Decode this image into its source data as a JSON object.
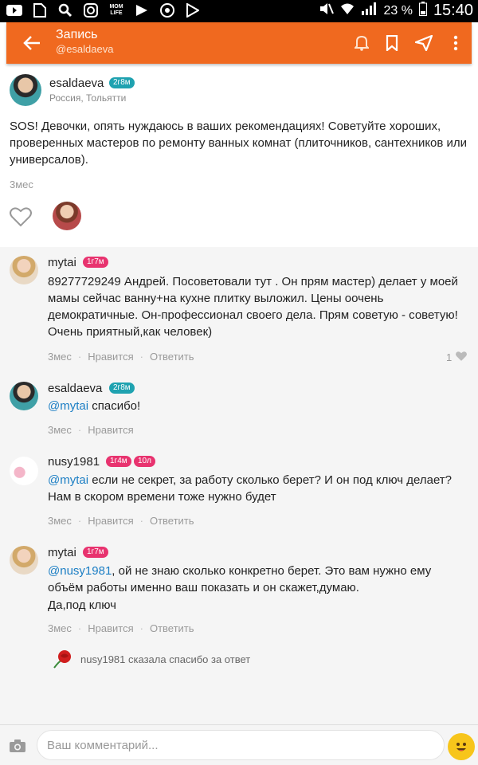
{
  "status_bar": {
    "icons": [
      "youtube-icon",
      "file-icon",
      "search-icon",
      "instagram-icon",
      "momlife-icon",
      "sportlink-icon",
      "chrome-icon",
      "play-store-icon"
    ],
    "momlife_label": "MOM LIFE",
    "battery_percent": "23 %",
    "time": "15:40"
  },
  "app_bar": {
    "title": "Запись",
    "subtitle": "@esaldaeva",
    "icons": [
      "back-arrow-icon",
      "bell-icon",
      "bookmark-icon",
      "share-icon",
      "more-vertical-icon"
    ]
  },
  "post": {
    "author": "esaldaeva",
    "badge": "2г8м",
    "location": "Россия, Тольятти",
    "text": "SOS! Девочки, опять нуждаюсь в ваших рекомендациях! Советуйте хороших, проверенных мастеров по ремонту ванных комнат (плиточников, сантехников или универсалов).",
    "time": "3мес"
  },
  "comments": [
    {
      "author": "mytai",
      "badges": [
        "1г7м"
      ],
      "text": "89277729249 Андрей. Посоветовали тут . Он прям мастер) делает у моей мамы сейчас ванну+на кухне плитку выложил. Цены оочень демократичные. Он-профессионал своего дела. Прям советую - советую! Очень приятный,как человек)",
      "time": "3мес",
      "like_label": "Нравится",
      "reply_label": "Ответить",
      "likes": "1"
    },
    {
      "author": "esaldaeva",
      "badges": [
        "2г8м"
      ],
      "mention": "@mytai",
      "text": " спасибо!",
      "time": "3мес",
      "like_label": "Нравится"
    },
    {
      "author": "nusy1981",
      "badges": [
        "1г4м",
        "10л"
      ],
      "mention": "@mytai",
      "text": " если не секрет, за работу сколько берет? И он под ключ делает? Нам в скором времени тоже нужно будет",
      "time": "3мес",
      "like_label": "Нравится",
      "reply_label": "Ответить"
    },
    {
      "author": "mytai",
      "badges": [
        "1г7м"
      ],
      "mention": "@nusy1981",
      "text": ", ой не знаю сколько конкретно берет. Это вам нужно ему объём работы именно ваш показать и он скажет,думаю.",
      "text2": "Да,под ключ",
      "time": "3мес",
      "like_label": "Нравится",
      "reply_label": "Ответить",
      "thanks_user": "nusy1981",
      "thanks_text": "сказала спасибо за ответ"
    }
  ],
  "input": {
    "placeholder": "Ваш комментарий..."
  },
  "colors": {
    "accent": "#f0691f",
    "link": "#1b7ec4",
    "badge_teal": "#1fa2b0",
    "badge_pink": "#e8336f"
  }
}
